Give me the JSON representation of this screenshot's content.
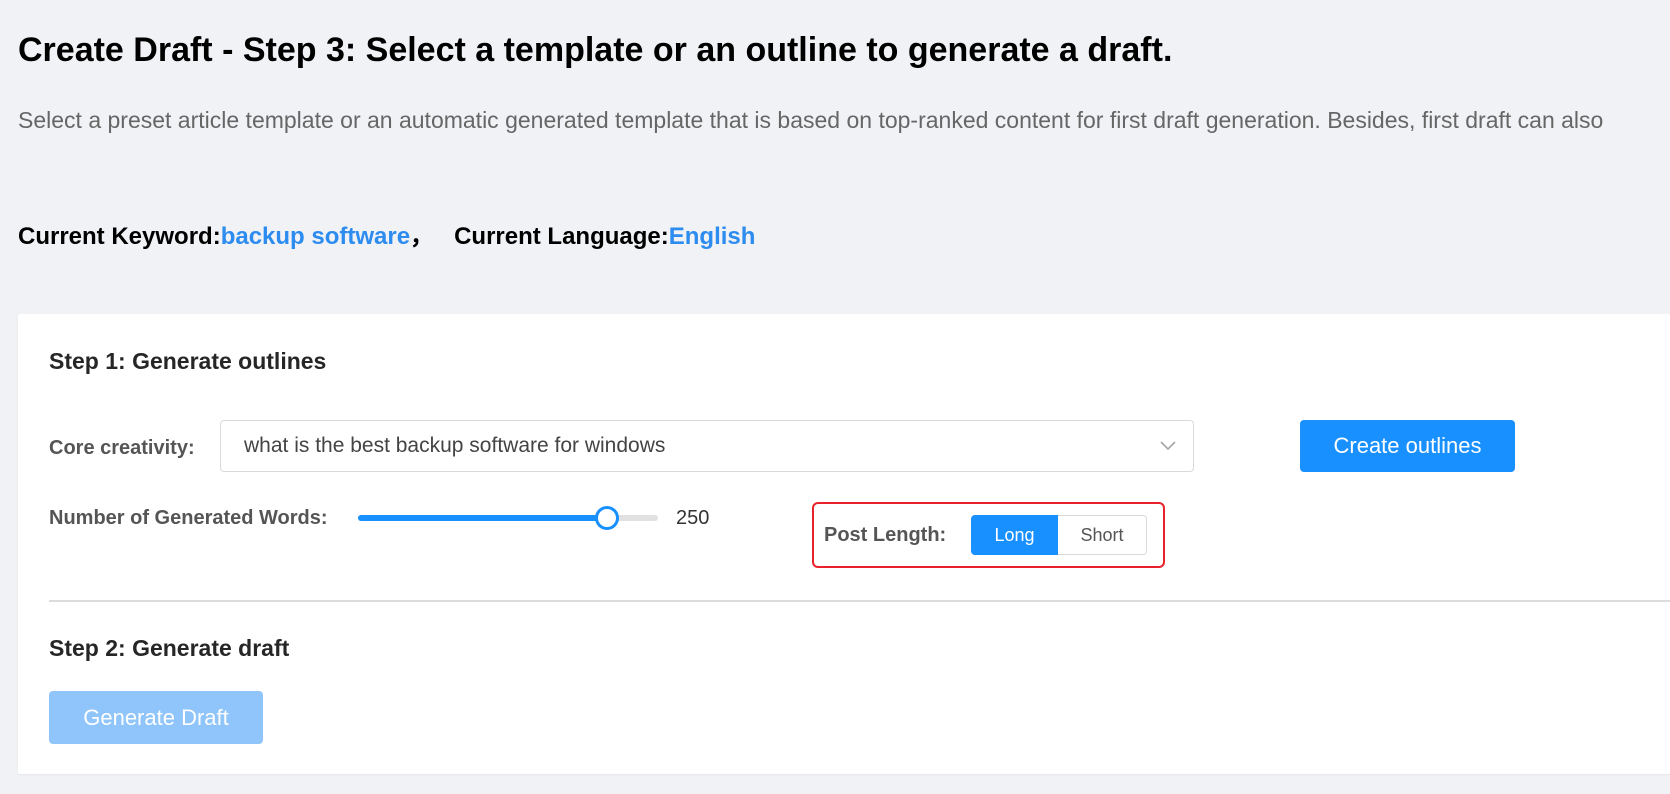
{
  "header": {
    "title": "Create Draft - Step 3: Select a template or an outline to generate a draft.",
    "description": "Select a preset article template or an automatic generated template that is based on top-ranked content for first draft generation. Besides, first draft can also"
  },
  "context": {
    "keyword_label": "Current Keyword:",
    "keyword_value": "backup software",
    "separator": "，",
    "language_label": "Current Language:",
    "language_value": "English"
  },
  "step1": {
    "title": "Step 1: Generate outlines",
    "core_creativity_label": "Core creativity:",
    "core_creativity_value": "what is the best backup software for windows",
    "create_button": "Create outlines",
    "words_label": "Number of Generated Words:",
    "words_value": "250",
    "words_slider_fraction": 0.83,
    "post_length_label": "Post Length:",
    "post_length_options": [
      "Long",
      "Short"
    ],
    "post_length_selected": "Long"
  },
  "step2": {
    "title": "Step 2: Generate draft",
    "generate_button": "Generate Draft"
  },
  "colors": {
    "primary": "#1890ff",
    "link": "#2d8cf0",
    "disabled_primary": "#90c5fb",
    "highlight": "#e8212b",
    "background": "#f0f2f5"
  },
  "icons": {
    "select_arrow": "chevron-down-icon"
  }
}
